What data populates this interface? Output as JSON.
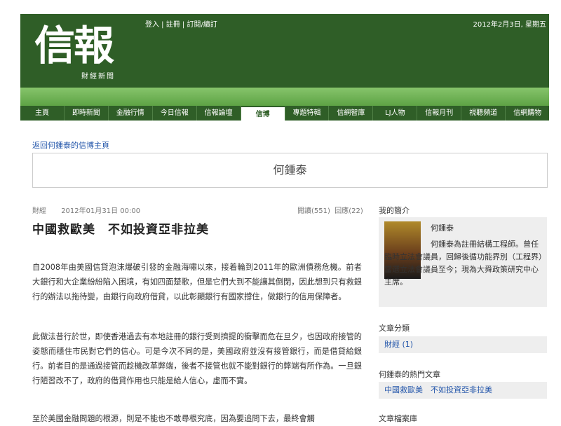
{
  "header": {
    "logo": "信報",
    "logo_sub": "財經新聞",
    "links": [
      "登入",
      "註冊",
      "訂閱/續訂"
    ],
    "date": "2012年2月3日, 星期五"
  },
  "nav": {
    "items": [
      "主頁",
      "即時新聞",
      "金融行情",
      "今日信報",
      "信報論壇",
      "信博",
      "專題特輯",
      "信網智庫",
      "LJ人物",
      "信報月刊",
      "視聽頻道",
      "信網購物"
    ],
    "active": "信博"
  },
  "back_link": "返回何鍾泰的信博主頁",
  "blogger_name": "何鍾泰",
  "post": {
    "category": "財經",
    "date": "2012年01月31日 00:00",
    "reads": "閱讀(551)",
    "replies": "回應(22)",
    "title": "中國救歐美　不如投資亞非拉美",
    "paragraphs": [
      "自2008年由美國信貸泡沫爆破引發的金融海嘯以來，接着輪到2011年的歐洲債務危機。前者大銀行和大企業紛紛陷入困境，有如四面楚歌，但是它們大到不能讓其倒閉，因此想到只有救銀行的辦法以拖待變，由銀行向政府借貸，以此彰顯銀行有國家撐住，做銀行的信用保障者。",
      "此做法昔行於世，即使香港過去有本地註冊的銀行受到擠提的衝擊而危在旦夕，也因政府接管的姿態而穩住市民對它們的信心。可是今次不同的是，美國政府並沒有接管銀行，而是借貸給銀行。前者目的是通過接管而趁機改革弊端，後者不接管也就不能對銀行的弊端有所作為。一旦銀行陋習改不了，政府的借貸作用也只能是給人信心，虛而不實。",
      "至於美國金融問題的根源，則是不能也不敢尋根究底，因為要追問下去，最終會觸"
    ]
  },
  "sidebar": {
    "profile_heading": "我的簡介",
    "profile_name": "何鍾泰",
    "profile_text": "何鍾泰為註冊結構工程師。曾任臨時立法會議員，回歸後循功能界別（工程界）當選立法會議員至今；現為大舜政策研究中心主席。",
    "category_heading": "文章分類",
    "category_item": "財經 (1)",
    "hot_heading": "何鍾泰的熱門文章",
    "hot_item": "中國救歐美　不如投資亞非拉美",
    "archive_heading": "文章檔案庫"
  }
}
